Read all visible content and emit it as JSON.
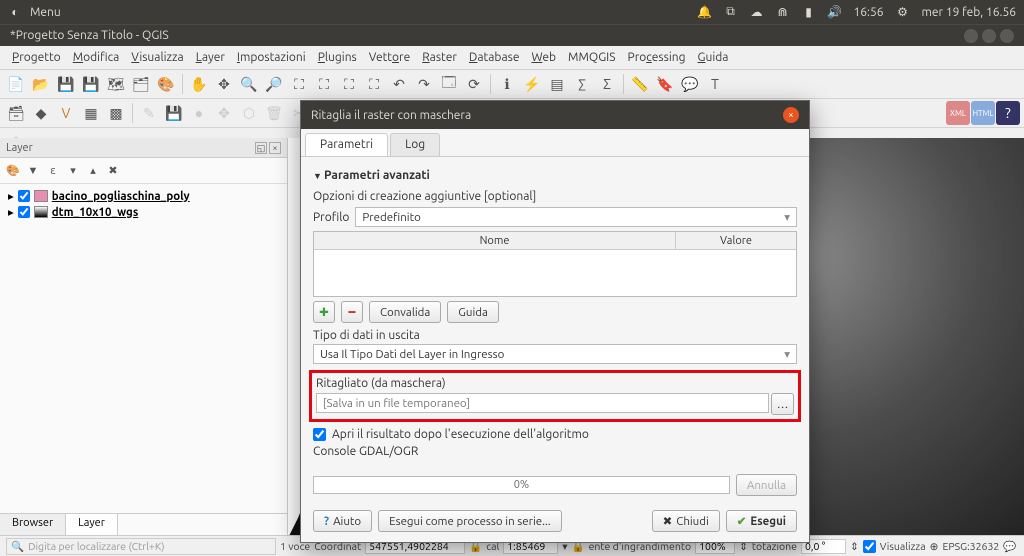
{
  "sysbar": {
    "menu": "Menu",
    "time": "16:56",
    "date": "mer 19 feb, 16.56"
  },
  "titlebar": {
    "title": "*Progetto Senza Titolo - QGIS"
  },
  "menubar": [
    "Progetto",
    "Modifica",
    "Visualizza",
    "Layer",
    "Impostazioni",
    "Plugins",
    "Vettore",
    "Raster",
    "Database",
    "Web",
    "MMQGIS",
    "Processing",
    "Guida"
  ],
  "layerspanel": {
    "title": "Layer",
    "items": [
      {
        "name": "bacino_pogliaschina_poly",
        "color": "#e78fb2"
      },
      {
        "name": "dtm_10x10_wgs",
        "color_grad": true
      }
    ]
  },
  "tabs": {
    "browser": "Browser",
    "layer": "Layer"
  },
  "statusbar": {
    "locator_ph": "Digita per localizzare (Ctrl+K)",
    "feat": "1 voce",
    "coord_lbl": "Coordinate",
    "coord": "547551,4902284",
    "scale_lbl": "Scala",
    "scale": "1:85469",
    "mag_lbl": "Lente d'ingrandimento",
    "mag": "100%",
    "rot_lbl": "Rotazione",
    "rot": "0,0 °",
    "render": "Visualizza",
    "epsg": "EPSG:32632"
  },
  "dialog": {
    "title": "Ritaglia il raster con maschera",
    "tabs": {
      "params": "Parametri",
      "log": "Log"
    },
    "adv_hdr": "Parametri avanzati",
    "opts_lbl": "Opzioni di creazione aggiuntive [optional]",
    "profile_lbl": "Profilo",
    "profile_val": "Predefinito",
    "col_name": "Nome",
    "col_value": "Valore",
    "validate": "Convalida",
    "guide": "Guida",
    "dtype_lbl": "Tipo di dati in uscita",
    "dtype_val": "Usa Il Tipo Dati del Layer in Ingresso",
    "output_lbl": "Ritagliato (da maschera)",
    "output_ph": "[Salva in un file temporaneo]",
    "open_after": "Apri il risultato dopo l'esecuzione dell'algoritmo",
    "console_lbl": "Console GDAL/OGR",
    "progress": "0%",
    "cancel": "Annulla",
    "help": "Aiuto",
    "batch": "Esegui come processo in serie...",
    "close": "Chiudi",
    "run": "Esegui"
  }
}
